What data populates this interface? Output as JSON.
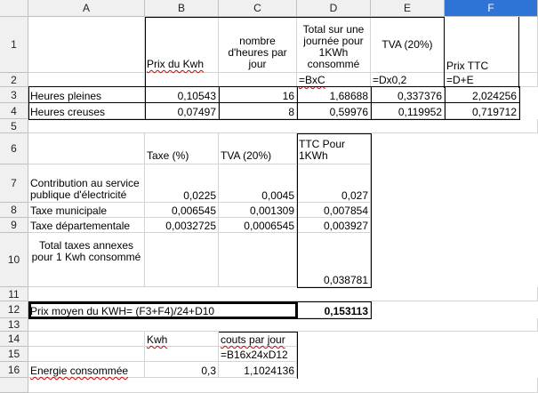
{
  "columns": [
    "A",
    "B",
    "C",
    "D",
    "E",
    "F"
  ],
  "selected_column": "F",
  "rows": [
    "1",
    "2",
    "3",
    "4",
    "5",
    "6",
    "7",
    "8",
    "9",
    "10",
    "11",
    "12",
    "13",
    "14",
    "15",
    "16"
  ],
  "cells": {
    "B1": "Prix du Kwh",
    "C1": "nombre d'heures par jour",
    "D1": "Total sur une journée pour 1KWh consommé",
    "E1": "TVA (20%)",
    "F1": "Prix TTC",
    "D2": "=BxC",
    "E2": "=Dx0,2",
    "F2": "=D+E",
    "A3": "Heures pleines",
    "B3": "0,10543",
    "C3": "16",
    "D3": "1,68688",
    "E3": "0,337376",
    "F3": "2,024256",
    "A4": "Heures creuses",
    "B4": "0,07497",
    "C4": "8",
    "D4": "0,59976",
    "E4": "0,119952",
    "F4": "0,719712",
    "B6": "Taxe (%)",
    "C6": "TVA (20%)",
    "D6": "TTC Pour 1KWh",
    "A7": "Contribution au service publique d'électricité",
    "B7": "0,0225",
    "C7": "0,0045",
    "D7": "0,027",
    "A8": "Taxe municipale",
    "B8": "0,006545",
    "C8": "0,001309",
    "D8": "0,007854",
    "A9": "Taxe départementale",
    "B9": "0,0032725",
    "C9": "0,0006545",
    "D9": "0,003927",
    "A10": "Total taxes annexes pour 1 Kwh consommé",
    "D10": "0,038781",
    "A12": "Prix moyen du KWH= (F3+F4)/24+D10",
    "D12": "0,153113",
    "B14": "Kwh",
    "C14": "couts par jour",
    "C15": "=B16x24xD12",
    "A16": "Energie consommée",
    "B16": "0,3",
    "C16": "1,1024136"
  }
}
